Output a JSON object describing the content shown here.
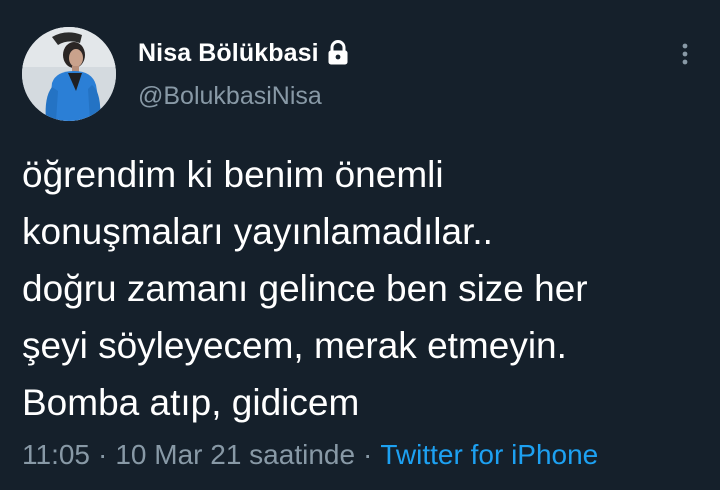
{
  "user": {
    "display_name": "Nisa Bölükbasi",
    "handle": "@BolukbasiNisa",
    "protected_icon": "lock-icon",
    "avatar": "profile-photo"
  },
  "menu": {
    "icon": "vertical-ellipsis-icon"
  },
  "tweet": {
    "text": "öğrendim ki benim önemli\nkonuşmaları yayınlamadılar..\ndoğru zamanı gelince ben size her\nşeyi söyleyecem, merak etmeyin.\nBomba atıp, gidicem",
    "time": "11:05",
    "date": "10 Mar 21 saatinde",
    "separator": "·",
    "source": "Twitter for iPhone"
  },
  "colors": {
    "background": "#15202b",
    "primary_text": "#ffffff",
    "secondary_text": "#8899a6",
    "link": "#1da1f2"
  }
}
